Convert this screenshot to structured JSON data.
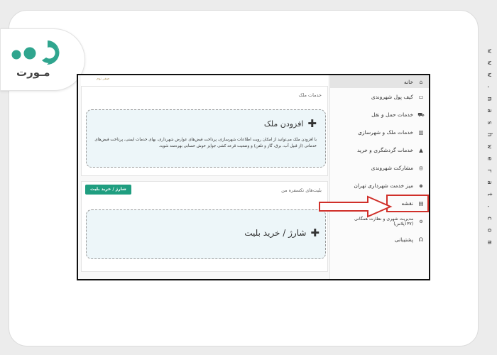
{
  "logo": {
    "text": "مـورت"
  },
  "watermark": {
    "site": "w w w . m a s h w e r a t . c o m"
  },
  "header": {
    "note": "صفر توم"
  },
  "sidebar": {
    "items": [
      {
        "label": "خانه",
        "icon": "home-icon"
      },
      {
        "label": "کیف پول شهروندی",
        "icon": "wallet-icon"
      },
      {
        "label": "خدمات حمل و نقل",
        "icon": "car-icon"
      },
      {
        "label": "خدمات ملک و شهرسازی",
        "icon": "building-icon"
      },
      {
        "label": "خدمات گردشگری و خرید",
        "icon": "shopping-bag-icon"
      },
      {
        "label": "مشارکت شهروندی",
        "icon": "handshake-icon"
      },
      {
        "label": "میز خدمت شهرداری تهران",
        "icon": "box-icon"
      },
      {
        "label": "نقشه",
        "icon": "map-icon"
      },
      {
        "label": "مدیریت شهری و نظارت همگانی (۱۳۷پلاس)",
        "icon": "gear-icon"
      },
      {
        "label": "پشتیبانی",
        "icon": "headset-icon"
      }
    ]
  },
  "property_panel": {
    "title": "خدمات ملک",
    "add_label": "افزودن ملک",
    "description": "با افزودن ملک می‌توانید از امکان رویت اطلاعات شهرسازی، پرداخت قبض‌های عوارض شهرداری، بهای خدمات ایمنی، پرداخت قبض‌های خدماتی (از قبیل آب، برق، گاز و تلفن) و وضعیت قرعه کشی جوایز خوش حسابی بهره‌مند شوید."
  },
  "ticket_panel": {
    "title": "بلیت‌های تکسفره من",
    "button_label": "شارژ / خرید بلیت",
    "add_label": "شارژ / خرید بلیت"
  },
  "colors": {
    "accent": "#1f9e80",
    "highlight": "#d0302a",
    "logo": "#2fa58e"
  }
}
